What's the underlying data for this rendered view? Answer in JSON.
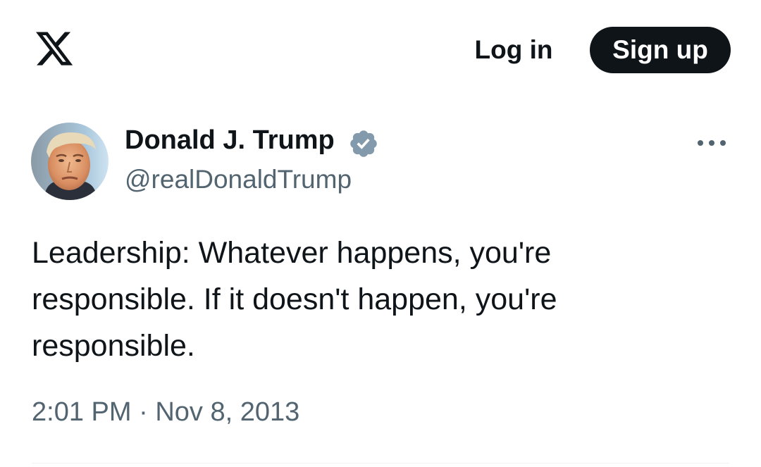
{
  "header": {
    "logo_icon": "x-logo-icon",
    "login_label": "Log in",
    "signup_label": "Sign up"
  },
  "tweet": {
    "author": {
      "display_name": "Donald J. Trump",
      "handle": "@realDonaldTrump",
      "verified": true,
      "verified_color": "#829aab"
    },
    "text_lines": [
      "Leadership: Whatever happens, you're",
      "responsible. If it doesn't happen, you're",
      "responsible."
    ],
    "time": "2:01 PM",
    "separator": "·",
    "date": "Nov 8, 2013"
  },
  "colors": {
    "primary_text": "#0f1419",
    "secondary_text": "#536471",
    "button_dark": "#0f1419",
    "divider": "#eff3f4"
  }
}
